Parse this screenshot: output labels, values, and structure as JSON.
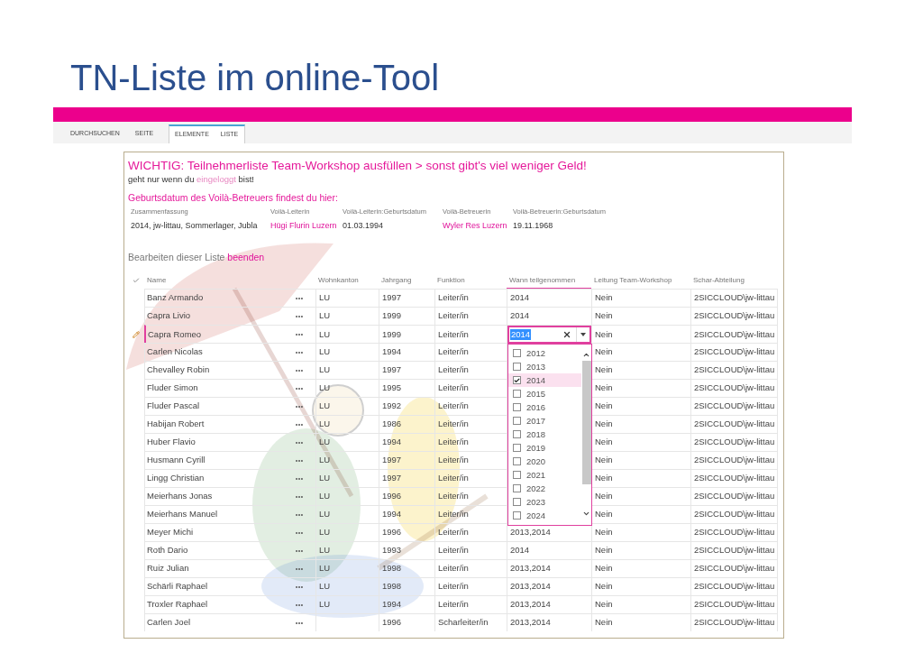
{
  "slide": {
    "title": "TN-Liste im online-Tool"
  },
  "ribbon": {
    "tabs": [
      {
        "label": "DURCHSUCHEN",
        "grouped": false
      },
      {
        "label": "SEITE",
        "grouped": false
      },
      {
        "label": "ELEMENTE",
        "grouped": true
      },
      {
        "label": "LISTE",
        "grouped": true
      }
    ]
  },
  "notice": {
    "heading": "WICHTIG: Teilnehmerliste Team-Workshop ausfüllen > sonst gibt's viel weniger Geld!",
    "login_note": {
      "before": "geht nur wenn du",
      "link": "eingeloggt",
      "after": "bist!"
    }
  },
  "summary": {
    "heading": "Geburtsdatum des Voilà-Betreuers findest du hier:",
    "columns": [
      "Zusammenfassung",
      "Voilà-Leiterin",
      "Voilà-Leiterin:Geburtsdatum",
      "Voilà-Betreuerin",
      "Voilà-Betreuerin:Geburtsdatum"
    ],
    "values": [
      {
        "text": "2014, jw-littau, Sommerlager, Jubla",
        "link": false
      },
      {
        "text": "Hügi Flurin Luzern",
        "link": true
      },
      {
        "text": "01.03.1994",
        "link": false
      },
      {
        "text": "Wyler Res Luzern",
        "link": true
      },
      {
        "text": "19.11.1968",
        "link": false
      }
    ]
  },
  "edit_note": {
    "text": "Bearbeiten dieser Liste",
    "link": "beenden"
  },
  "table": {
    "columns": [
      {
        "label": "Name",
        "active": false
      },
      {
        "label": "Wohnkanton",
        "active": false
      },
      {
        "label": "Jahrgang",
        "active": false
      },
      {
        "label": "Funktion",
        "active": false
      },
      {
        "label": "Wann teilgenommen",
        "active": true
      },
      {
        "label": "Leitung Team-Workshop",
        "active": false
      },
      {
        "label": "Schar-Abteilung",
        "active": false
      }
    ],
    "rows": [
      {
        "name": "Banz Armando",
        "kanton": "LU",
        "jahrgang": "1997",
        "funktion": "Leiter/in",
        "wann": "2014",
        "leitung": "Nein",
        "schar": "2SICCLOUD\\jw-littau",
        "editing": false
      },
      {
        "name": "Capra Livio",
        "kanton": "LU",
        "jahrgang": "1999",
        "funktion": "Leiter/in",
        "wann": "2014",
        "leitung": "Nein",
        "schar": "2SICCLOUD\\jw-littau",
        "editing": false
      },
      {
        "name": "Capra Romeo",
        "kanton": "LU",
        "jahrgang": "1999",
        "funktion": "Leiter/in",
        "leitung": "Nein",
        "schar": "2SICCLOUD\\jw-littau",
        "editing": true,
        "editor": {
          "value": "2014",
          "options": [
            {
              "label": "2012",
              "checked": false
            },
            {
              "label": "2013",
              "checked": false
            },
            {
              "label": "2014",
              "checked": true
            },
            {
              "label": "2015",
              "checked": false
            },
            {
              "label": "2016",
              "checked": false
            },
            {
              "label": "2017",
              "checked": false
            },
            {
              "label": "2018",
              "checked": false
            },
            {
              "label": "2019",
              "checked": false
            },
            {
              "label": "2020",
              "checked": false
            },
            {
              "label": "2021",
              "checked": false
            },
            {
              "label": "2022",
              "checked": false
            },
            {
              "label": "2023",
              "checked": false
            },
            {
              "label": "2024",
              "checked": false
            }
          ]
        }
      },
      {
        "name": "Carlen Nicolas",
        "kanton": "LU",
        "jahrgang": "1994",
        "funktion": "Leiter/in",
        "leitung": "Nein",
        "schar": "2SICCLOUD\\jw-littau",
        "editing": false
      },
      {
        "name": "Chevalley Robin",
        "kanton": "LU",
        "jahrgang": "1997",
        "funktion": "Leiter/in",
        "leitung": "Nein",
        "schar": "2SICCLOUD\\jw-littau",
        "editing": false
      },
      {
        "name": "Fluder Simon",
        "kanton": "LU",
        "jahrgang": "1995",
        "funktion": "Leiter/in",
        "leitung": "Nein",
        "schar": "2SICCLOUD\\jw-littau",
        "editing": false
      },
      {
        "name": "Fluder Pascal",
        "kanton": "LU",
        "jahrgang": "1992",
        "funktion": "Leiter/in",
        "leitung": "Nein",
        "schar": "2SICCLOUD\\jw-littau",
        "editing": false
      },
      {
        "name": "Habijan Robert",
        "kanton": "LU",
        "jahrgang": "1986",
        "funktion": "Leiter/in",
        "leitung": "Nein",
        "schar": "2SICCLOUD\\jw-littau",
        "editing": false
      },
      {
        "name": "Huber Flavio",
        "kanton": "LU",
        "jahrgang": "1994",
        "funktion": "Leiter/in",
        "leitung": "Nein",
        "schar": "2SICCLOUD\\jw-littau",
        "editing": false
      },
      {
        "name": "Husmann Cyrill",
        "kanton": "LU",
        "jahrgang": "1997",
        "funktion": "Leiter/in",
        "leitung": "Nein",
        "schar": "2SICCLOUD\\jw-littau",
        "editing": false
      },
      {
        "name": "Lingg Christian",
        "kanton": "LU",
        "jahrgang": "1997",
        "funktion": "Leiter/in",
        "leitung": "Nein",
        "schar": "2SICCLOUD\\jw-littau",
        "editing": false
      },
      {
        "name": "Meierhans Jonas",
        "kanton": "LU",
        "jahrgang": "1996",
        "funktion": "Leiter/in",
        "leitung": "Nein",
        "schar": "2SICCLOUD\\jw-littau",
        "editing": false
      },
      {
        "name": "Meierhans Manuel",
        "kanton": "LU",
        "jahrgang": "1994",
        "funktion": "Leiter/in",
        "leitung": "Nein",
        "schar": "2SICCLOUD\\jw-littau",
        "editing": false
      },
      {
        "name": "Meyer Michi",
        "kanton": "LU",
        "jahrgang": "1996",
        "funktion": "Leiter/in",
        "wann": "2013,2014",
        "leitung": "Nein",
        "schar": "2SICCLOUD\\jw-littau",
        "editing": false
      },
      {
        "name": "Roth Dario",
        "kanton": "LU",
        "jahrgang": "1993",
        "funktion": "Leiter/in",
        "wann": "2014",
        "leitung": "Nein",
        "schar": "2SICCLOUD\\jw-littau",
        "editing": false
      },
      {
        "name": "Ruiz Julian",
        "kanton": "LU",
        "jahrgang": "1998",
        "funktion": "Leiter/in",
        "wann": "2013,2014",
        "leitung": "Nein",
        "schar": "2SICCLOUD\\jw-littau",
        "editing": false
      },
      {
        "name": "Schärli Raphael",
        "kanton": "LU",
        "jahrgang": "1998",
        "funktion": "Leiter/in",
        "wann": "2013,2014",
        "leitung": "Nein",
        "schar": "2SICCLOUD\\jw-littau",
        "editing": false
      },
      {
        "name": "Troxler Raphael",
        "kanton": "LU",
        "jahrgang": "1994",
        "funktion": "Leiter/in",
        "wann": "2013,2014",
        "leitung": "Nein",
        "schar": "2SICCLOUD\\jw-littau",
        "editing": false
      },
      {
        "name": "Carlen Joel",
        "jahrgang": "1996",
        "funktion": "Scharleiter/in",
        "wann": "2013,2014",
        "leitung": "Nein",
        "schar": "2SICCLOUD\\jw-littau",
        "editing": false
      }
    ]
  }
}
